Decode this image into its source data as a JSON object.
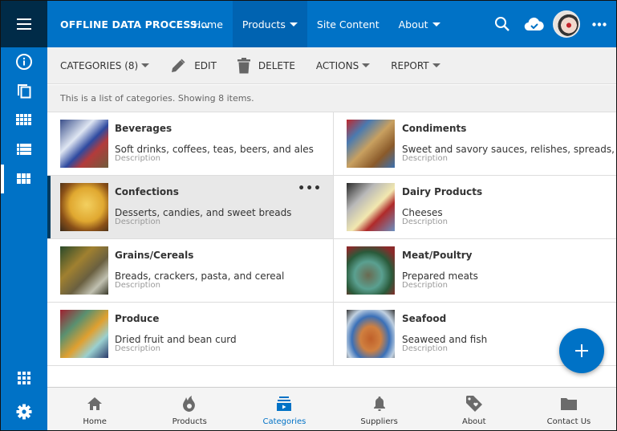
{
  "app": {
    "title": "OFFLINE DATA PROCESS...",
    "brand_color": "#0072c6",
    "rail_dark_color": "#002b48"
  },
  "topnav": {
    "items": [
      {
        "label": "Home",
        "has_caret": false,
        "active": false
      },
      {
        "label": "Products",
        "has_caret": true,
        "active": true
      },
      {
        "label": "Site Content",
        "has_caret": false,
        "active": false
      },
      {
        "label": "About",
        "has_caret": true,
        "active": false
      }
    ],
    "icons": [
      "search-icon",
      "cloud-check-icon",
      "avatar",
      "more-icon"
    ]
  },
  "rail": {
    "items": [
      "info-icon",
      "copy-icon",
      "grid-small-icon",
      "list-icon",
      "grid-large-icon"
    ],
    "active_index": 4,
    "bottom": [
      "apps-icon",
      "settings-icon"
    ]
  },
  "commands": {
    "categories": "CATEGORIES (8)",
    "edit": "EDIT",
    "delete": "DELETE",
    "actions": "ACTIONS",
    "report": "REPORT"
  },
  "info": "This is a list of categories. Showing 8 items.",
  "categories": [
    {
      "name": "Beverages",
      "description": "Soft drinks, coffees, teas, beers, and ales",
      "label": "Description",
      "selected": false
    },
    {
      "name": "Condiments",
      "description": "Sweet and savory sauces, relishes, spreads, and sea",
      "label": "Description",
      "selected": false
    },
    {
      "name": "Confections",
      "description": "Desserts, candies, and sweet breads",
      "label": "Description",
      "selected": true
    },
    {
      "name": "Dairy Products",
      "description": "Cheeses",
      "label": "Description",
      "selected": false
    },
    {
      "name": "Grains/Cereals",
      "description": "Breads, crackers, pasta, and cereal",
      "label": "Description",
      "selected": false
    },
    {
      "name": "Meat/Poultry",
      "description": "Prepared meats",
      "label": "Description",
      "selected": false
    },
    {
      "name": "Produce",
      "description": "Dried fruit and bean curd",
      "label": "Description",
      "selected": false
    },
    {
      "name": "Seafood",
      "description": "Seaweed and fish",
      "label": "Description",
      "selected": false
    }
  ],
  "more_glyph": "•••",
  "fab_glyph": "+",
  "tabs": [
    {
      "label": "Home",
      "icon": "home-icon",
      "active": false
    },
    {
      "label": "Products",
      "icon": "fire-icon",
      "active": false
    },
    {
      "label": "Categories",
      "icon": "media-stack-icon",
      "active": true
    },
    {
      "label": "Suppliers",
      "icon": "bell-icon",
      "active": false
    },
    {
      "label": "About",
      "icon": "tag-heart-icon",
      "active": false
    },
    {
      "label": "Contact Us",
      "icon": "folder-icon",
      "active": false
    }
  ]
}
